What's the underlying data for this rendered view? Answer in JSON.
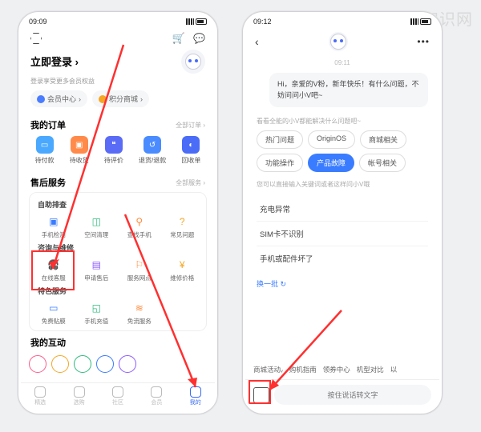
{
  "watermark": "爱创根知识网",
  "screen1": {
    "status_time": "09:09",
    "login_title": "立即登录",
    "login_arrow": "›",
    "login_sub": "登录享受更多会员权益",
    "chips": [
      {
        "icon_color": "#4a7cff",
        "label": "会员中心",
        "arrow": "›"
      },
      {
        "icon_color": "#f5a623",
        "label": "积分商城",
        "arrow": "›"
      }
    ],
    "orders": {
      "title": "我的订单",
      "more": "全部订单 ›",
      "items": [
        {
          "label": "待付款",
          "color": "#4aa8ff"
        },
        {
          "label": "待收货",
          "color": "#ff8a4a"
        },
        {
          "label": "待评价",
          "color": "#5a6cf5"
        },
        {
          "label": "退货/退款",
          "color": "#4a8cff"
        },
        {
          "label": "回收单",
          "color": "#4a6cf7"
        }
      ]
    },
    "service": {
      "title": "售后服务",
      "more": "全部服务 ›",
      "groups": [
        {
          "head": "自助排查",
          "items": [
            {
              "label": "手机检测",
              "color": "#3a7cff"
            },
            {
              "label": "空间清理",
              "color": "#2aba7a"
            },
            {
              "label": "查找手机",
              "color": "#ff8a3a"
            },
            {
              "label": "常见问题",
              "color": "#f5a623"
            }
          ]
        },
        {
          "head": "咨询与维修",
          "items": [
            {
              "label": "在线客服",
              "color": "#3a7cff"
            },
            {
              "label": "申请售后",
              "color": "#8a5aff"
            },
            {
              "label": "服务网点",
              "color": "#ff8a3a"
            },
            {
              "label": "维修价格",
              "color": "#f5a623"
            }
          ]
        },
        {
          "head": "特色服务",
          "items": [
            {
              "label": "免费贴膜",
              "color": "#3a7cff"
            },
            {
              "label": "手机充值",
              "color": "#2aba7a"
            },
            {
              "label": "免流服务",
              "color": "#ff8a3a"
            }
          ]
        }
      ]
    },
    "interact_title": "我的互动",
    "tabs": [
      {
        "label": "精选"
      },
      {
        "label": "选购"
      },
      {
        "label": "社区"
      },
      {
        "label": "会员"
      },
      {
        "label": "我的"
      }
    ]
  },
  "screen2": {
    "status_time": "09:12",
    "time_chip": "09:11",
    "greeting": "Hi，亲爱的V粉，新年快乐！有什么问题，不妨问问小V吧~",
    "hint1": "看看全能的小V都能解决什么问题吧~",
    "pills": [
      {
        "label": "热门问题"
      },
      {
        "label": "OriginOS"
      },
      {
        "label": "商城相关"
      },
      {
        "label": "功能操作"
      },
      {
        "label": "产品故障",
        "active": true
      },
      {
        "label": "帐号相关"
      }
    ],
    "hint2": "您可以直接输入关键词或者这样问小V哦",
    "faq": [
      "充电异常",
      "SIM卡不识别",
      "手机或配件坏了"
    ],
    "refresh": "换一批 ↻",
    "bottom_tags": [
      "商城活动ᵥ",
      "购机指南",
      "领券中心",
      "机型对比",
      "以"
    ],
    "voice_placeholder": "按住说话转文字"
  }
}
